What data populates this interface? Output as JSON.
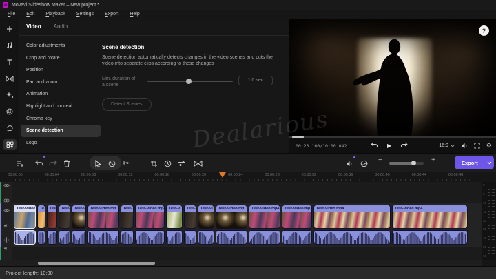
{
  "window": {
    "title": "Movavi Slideshow Maker – New project *"
  },
  "menu": {
    "items": [
      "File",
      "Edit",
      "Playback",
      "Settings",
      "Export",
      "Help"
    ]
  },
  "activity_bar": {
    "icons": [
      "add-media",
      "music",
      "titles",
      "transitions",
      "effects",
      "stickers",
      "rotate",
      "more-tools"
    ],
    "active": "more-tools"
  },
  "tools_panel": {
    "tabs": [
      {
        "label": "Video",
        "active": true
      },
      {
        "label": "Audio",
        "active": false
      }
    ],
    "items": [
      "Color adjustments",
      "Crop and rotate",
      "Position",
      "Pan and zoom",
      "Animation",
      "Highlight and conceal",
      "Chroma key",
      "Scene detection",
      "Logo"
    ],
    "selected_item": "Scene detection"
  },
  "scene_detection": {
    "title": "Scene detection",
    "description": "Scene detection automatically detects changes in the video scenes and cuts the video into separate clips according to these changes",
    "slider_label": "Min. duration of a scene",
    "slider_value_pct": 48,
    "value": "1.0 sec",
    "button": "Detect Scenes"
  },
  "preview": {
    "help_label": "?",
    "timecode": "00:23.160/10:00.042",
    "aspect": "16:9"
  },
  "toolbar": {
    "export_label": "Export",
    "zoom_pct": 70
  },
  "timeline": {
    "ruler_labels": [
      "00:00:00",
      "00:00:04",
      "00:00:08",
      "00:00:12",
      "00:00:16",
      "00:00:20",
      "00:00:24",
      "00:00:28",
      "00:00:32",
      "00:00:36",
      "00:00:40",
      "00:00:44",
      "00:00:48"
    ],
    "clips": [
      {
        "name": "Test-Video",
        "width": 32,
        "thumb": "indoor",
        "selected": true
      },
      {
        "name": "Te",
        "width": 12,
        "thumb": "sunset",
        "selected": false
      },
      {
        "name": "Tes",
        "width": 15,
        "thumb": "darkred",
        "selected": false
      },
      {
        "name": "Test-",
        "width": 17,
        "thumb": "dark",
        "selected": false
      },
      {
        "name": "Test-V",
        "width": 21,
        "thumb": "cave",
        "selected": false
      },
      {
        "name": "Test-Video.mp",
        "width": 46,
        "thumb": "people",
        "selected": false
      },
      {
        "name": "Test-",
        "width": 19,
        "thumb": "dark",
        "selected": false
      },
      {
        "name": "Test-Video.mp4",
        "width": 43,
        "thumb": "people",
        "selected": false
      },
      {
        "name": "Test-V",
        "width": 24,
        "thumb": "field",
        "selected": false
      },
      {
        "name": "Test-",
        "width": 18,
        "thumb": "dark",
        "selected": false
      },
      {
        "name": "Test-Vi",
        "width": 24,
        "thumb": "cave",
        "selected": false
      },
      {
        "name": "Test-Video.mp",
        "width": 46,
        "thumb": "cave",
        "selected": false
      },
      {
        "name": "Test-Video.mp4",
        "width": 46,
        "thumb": "people",
        "selected": false
      },
      {
        "name": "Test-Video.mp",
        "width": 44,
        "thumb": "people",
        "selected": false
      },
      {
        "name": "Test-Video.mp4",
        "width": 112,
        "thumb": "market",
        "selected": false
      },
      {
        "name": "Test-Video.mp4",
        "width": 110,
        "thumb": "market",
        "selected": false
      }
    ],
    "meter_labels": [
      "0",
      "6",
      "10",
      "15",
      "20",
      "30",
      "40",
      "50",
      "60"
    ]
  },
  "statusbar": {
    "project_length": "Project length: 10:00"
  },
  "watermark": {
    "text": "Dealarious"
  },
  "colors": {
    "accent_purple": "#6e57e8",
    "playhead_orange": "#e87722",
    "clip_header": "#8b90dc",
    "clip_selected": "#d7ddf6",
    "track_strip_green": "#2f9e6e",
    "track_strip_purple": "#8a8fe0"
  }
}
